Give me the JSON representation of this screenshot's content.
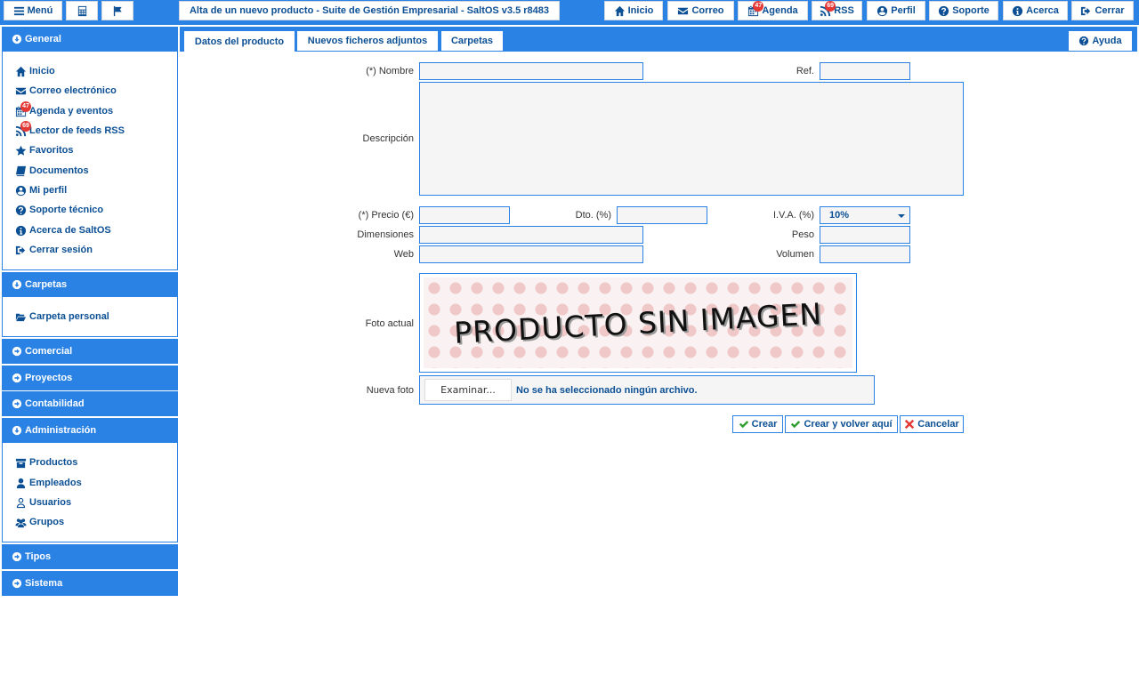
{
  "topbar": {
    "menu_label": "Menú",
    "title": "Alta de un nuevo producto - Suite de Gestión Empresarial - SaltOS v3.5 r8483",
    "nav": {
      "inicio": "Inicio",
      "correo": "Correo",
      "agenda": "Agenda",
      "agenda_badge": "47",
      "rss": "RSS",
      "rss_badge": "69",
      "perfil": "Perfil",
      "soporte": "Soporte",
      "acerca": "Acerca",
      "cerrar": "Cerrar"
    }
  },
  "sidebar": {
    "general": {
      "header": "General",
      "items": [
        {
          "label": "Inicio",
          "icon": "home-icon"
        },
        {
          "label": "Correo electrónico",
          "icon": "envelope-icon"
        },
        {
          "label": "Agenda y eventos",
          "icon": "calendar-icon",
          "badge": "47"
        },
        {
          "label": "Lector de feeds RSS",
          "icon": "rss-icon",
          "badge": "69"
        },
        {
          "label": "Favoritos",
          "icon": "star-icon"
        },
        {
          "label": "Documentos",
          "icon": "book-icon"
        },
        {
          "label": "Mi perfil",
          "icon": "user-circle-icon"
        },
        {
          "label": "Soporte técnico",
          "icon": "question-icon"
        },
        {
          "label": "Acerca de SaltOS",
          "icon": "info-icon"
        },
        {
          "label": "Cerrar sesión",
          "icon": "sign-out-icon"
        }
      ]
    },
    "carpetas": {
      "header": "Carpetas",
      "items": [
        {
          "label": "Carpeta personal",
          "icon": "folder-open-icon"
        }
      ]
    },
    "comercial": {
      "header": "Comercial"
    },
    "proyectos": {
      "header": "Proyectos"
    },
    "contabilidad": {
      "header": "Contabilidad"
    },
    "administracion": {
      "header": "Administración",
      "items": [
        {
          "label": "Productos",
          "icon": "archive-icon"
        },
        {
          "label": "Empleados",
          "icon": "user-icon"
        },
        {
          "label": "Usuarios",
          "icon": "user-outline-icon"
        },
        {
          "label": "Grupos",
          "icon": "users-icon"
        }
      ]
    },
    "tipos": {
      "header": "Tipos"
    },
    "sistema": {
      "header": "Sistema"
    }
  },
  "tabs": {
    "items": [
      "Datos del producto",
      "Nuevos ficheros adjuntos",
      "Carpetas"
    ],
    "active": 0,
    "help_label": "Ayuda"
  },
  "form": {
    "nombre_label": "(*) Nombre",
    "ref_label": "Ref.",
    "descripcion_label": "Descripción",
    "precio_label": "(*) Precio (€)",
    "dto_label": "Dto. (%)",
    "iva_label": "I.V.A. (%)",
    "iva_value": "10%",
    "dimensiones_label": "Dimensiones",
    "peso_label": "Peso",
    "web_label": "Web",
    "volumen_label": "Volumen",
    "foto_actual_label": "Foto actual",
    "foto_placeholder_text": "PRODUCTO SIN IMAGEN",
    "nueva_foto_label": "Nueva foto",
    "file_button": "Examinar...",
    "file_status": "No se ha seleccionado ningún archivo."
  },
  "actions": {
    "crear": "Crear",
    "crear_volver": "Crear y volver aquí",
    "cancelar": "Cancelar"
  },
  "colors": {
    "accent": "#2a82e4",
    "link_text": "#0b4f94",
    "ok_green": "#2e9e2e",
    "cancel_red": "#e53935"
  }
}
